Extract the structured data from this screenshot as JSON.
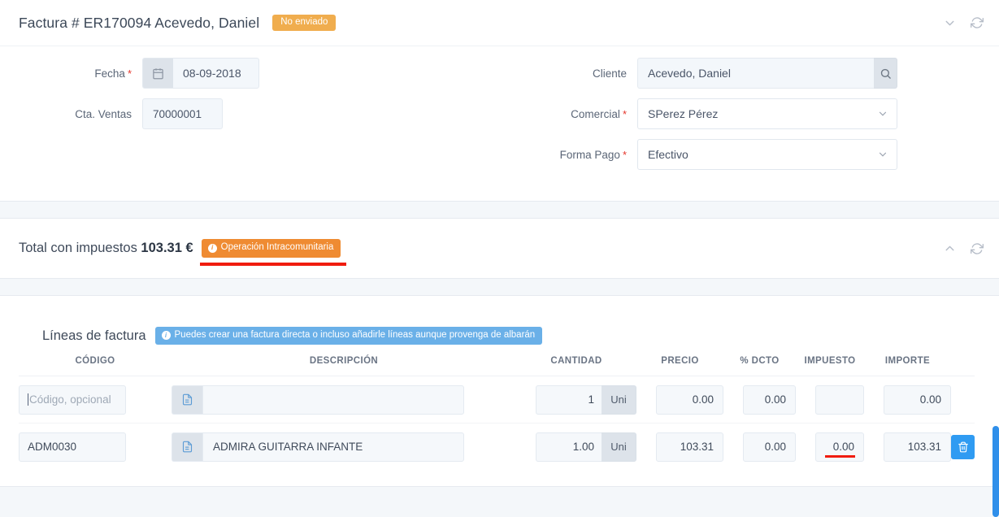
{
  "header": {
    "title": "Factura # ER170094 Acevedo, Daniel",
    "status_badge": "No enviado",
    "collapse_icon": "chevron-down-icon",
    "refresh_icon": "refresh-icon",
    "fields": {
      "fecha_label": "Fecha",
      "fecha_value": "08-09-2018",
      "fecha_icon": "calendar-icon",
      "cta_ventas_label": "Cta. Ventas",
      "cta_ventas_value": "70000001",
      "cliente_label": "Cliente",
      "cliente_value": "Acevedo, Daniel",
      "cliente_search_icon": "search-icon",
      "comercial_label": "Comercial",
      "comercial_value": "SPerez Pérez",
      "forma_pago_label": "Forma Pago",
      "forma_pago_value": "Efectivo",
      "required_marker": "*"
    }
  },
  "totals": {
    "label_prefix": "Total con impuestos",
    "amount": "103.31 €",
    "badge": "Operación Intracomunitaria",
    "badge_icon": "info-icon",
    "collapse_icon": "chevron-up-icon",
    "refresh_icon": "refresh-icon"
  },
  "lines": {
    "title": "Líneas de factura",
    "hint_badge": "Puedes crear una factura directa o incluso añadirle líneas aunque provenga de albarán",
    "hint_icon": "info-icon",
    "columns": {
      "codigo": "CÓDIGO",
      "descripcion": "DESCRIPCIÓN",
      "cantidad": "CANTIDAD",
      "precio": "PRECIO",
      "dcto": "% DCTO",
      "impuesto": "IMPUESTO",
      "importe": "IMPORTE"
    },
    "rows": [
      {
        "codigo": "",
        "codigo_placeholder": "Código, opcional",
        "descripcion": "",
        "desc_icon": "document-icon",
        "cantidad": "1",
        "unidad": "Uni",
        "precio": "0.00",
        "dcto": "0.00",
        "impuesto": "",
        "importe": "0.00",
        "has_delete": false,
        "tax_highlighted": false
      },
      {
        "codigo": "ADM0030",
        "codigo_placeholder": "Código, opcional",
        "descripcion": "ADMIRA GUITARRA INFANTE",
        "desc_icon": "document-icon",
        "cantidad": "1.00",
        "unidad": "Uni",
        "precio": "103.31",
        "dcto": "0.00",
        "impuesto": "0.00",
        "importe": "103.31",
        "has_delete": true,
        "delete_icon": "trash-icon",
        "tax_highlighted": true
      }
    ]
  },
  "colors": {
    "status_orange": "#f0ad4e",
    "badge_orange": "#ef8b32",
    "badge_blue": "#6ab0e8",
    "highlight_red": "#f01c0e",
    "delete_blue": "#2f9bf2",
    "scrollbar_blue": "#2f8fea",
    "required_red": "#e5352b"
  }
}
